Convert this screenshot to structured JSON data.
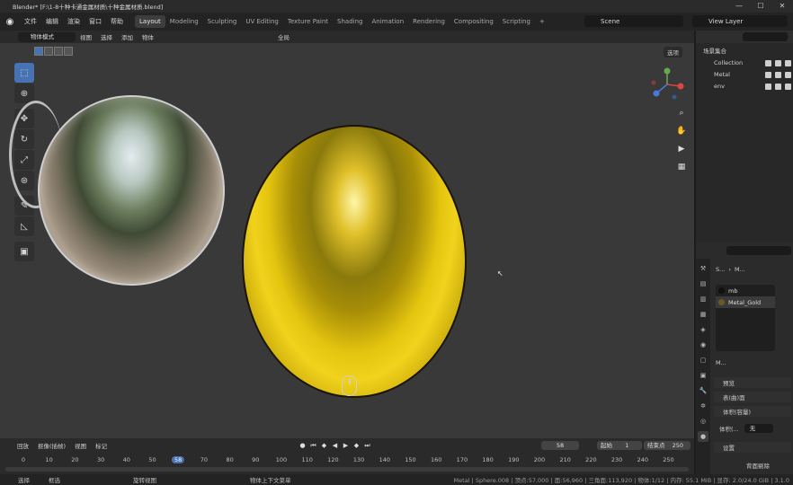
{
  "window": {
    "title": "Blender* [F:\\1-8十种卡通金属材质\\十种金属材质.blend]",
    "controls": [
      "—",
      "☐",
      "✕"
    ]
  },
  "menubar": {
    "menus": [
      "文件",
      "编辑",
      "渲染",
      "窗口",
      "帮助"
    ],
    "tabs": [
      "Layout",
      "Modeling",
      "Sculpting",
      "UV Editing",
      "Texture Paint",
      "Shading",
      "Animation",
      "Rendering",
      "Compositing",
      "Scripting",
      "+"
    ],
    "active_tab": "Layout",
    "scene": "Scene",
    "view_layer": "View Layer"
  },
  "viewport": {
    "mode": "物体模式",
    "menus": [
      "视图",
      "选择",
      "添加",
      "物体"
    ],
    "transform_orientation": "全局",
    "options_label": "选项"
  },
  "outliner": {
    "root": "场景集合",
    "items": [
      {
        "label": "Collection"
      },
      {
        "label": "Metal"
      },
      {
        "label": "env"
      }
    ]
  },
  "properties": {
    "breadcrumb": [
      "S...",
      "M..."
    ],
    "materials": [
      {
        "name": "mb",
        "color": "#111111"
      },
      {
        "name": "Metal_Gold",
        "color": "#6a5a20"
      }
    ],
    "mat_field": "M...",
    "sections": [
      "预览",
      "表(曲)面",
      "体积(容量)"
    ],
    "volume_label": "体积(...",
    "volume_value": "无",
    "settings_label": "设置",
    "backface_label": "背面剔除"
  },
  "timeline": {
    "menus": [
      "回放",
      "抠像(插帧)",
      "视图",
      "标记"
    ],
    "current_frame": "58",
    "start_label": "起始",
    "start_value": "1",
    "end_label": "结束点",
    "end_value": "250",
    "ticks": [
      "0",
      "10",
      "20",
      "30",
      "40",
      "50",
      "58",
      "70",
      "80",
      "90",
      "100",
      "110",
      "120",
      "130",
      "140",
      "150",
      "160",
      "170",
      "180",
      "190",
      "200",
      "210",
      "220",
      "230",
      "240",
      "250"
    ]
  },
  "statusbar": {
    "select": "选择",
    "box_select": "框选",
    "rotate_view": "旋转视图",
    "context_menu": "物体上下文菜单",
    "stats": "Metal | Sphere.008 | 顶点:57,000 | 面:56,960 | 三角面:113,920 | 物体:1/12 | 内存: 55.1 MiB | 显存: 2.0/24.0 GiB | 3.1.0"
  }
}
